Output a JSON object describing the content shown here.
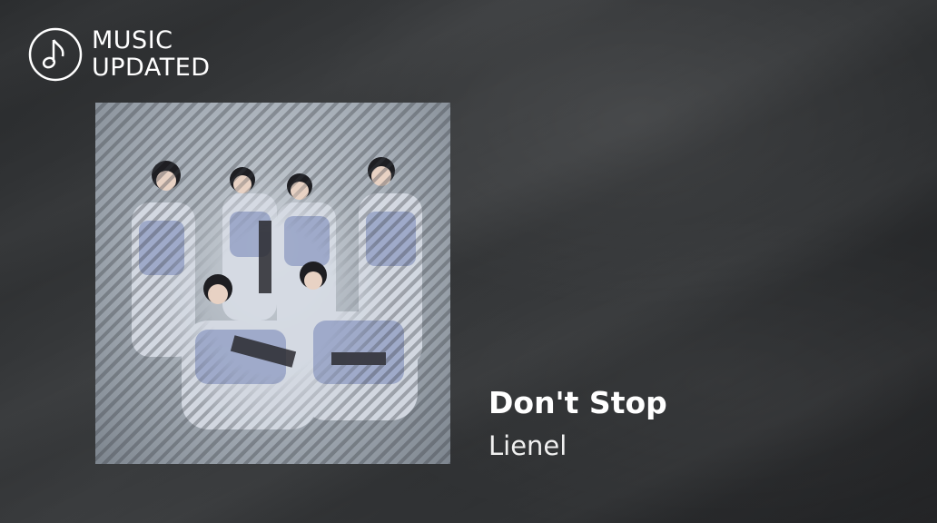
{
  "logo": {
    "line1": "MUSIC",
    "line2": "UPDATED",
    "icon": "music-note-icon"
  },
  "track": {
    "title": "Don't Stop",
    "artist": "Lienel",
    "album_art": "group-photo-artwork"
  }
}
